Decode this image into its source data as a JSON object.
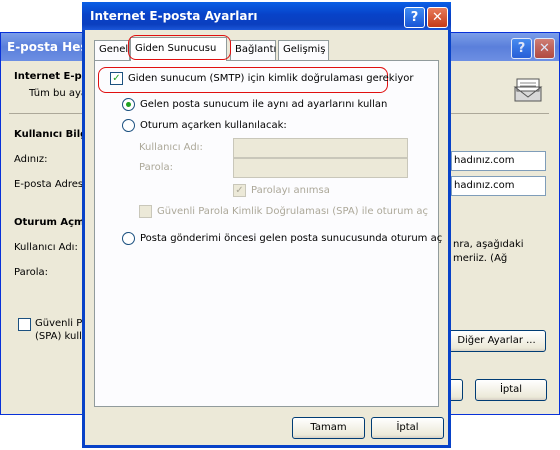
{
  "background_window": {
    "title": "E-posta Hesa",
    "heading": "Internet E-p",
    "subheading": "Tüm bu aya",
    "user_info_heading": "Kullanıcı Bilg",
    "name_label": "Adınız:",
    "email_label": "E-posta Adres",
    "name_value": "hadınız.com",
    "email_value": "hadınız.com",
    "logon_heading": "Oturum Açm",
    "username_label": "Kullanıcı Adı:",
    "password_label": "Parola:",
    "right_text_1": "nra, aşağıdaki",
    "right_text_2": "meriiz. (Ağ",
    "spa_label_1": "Güvenli Pa",
    "spa_label_2": "(SPA) kulla",
    "more_settings_button": "Diğer Ayarlar ...",
    "cancel_button": "İptal",
    "help_glyph": "?",
    "close_glyph": "✕"
  },
  "dialog": {
    "title": "Internet E-posta Ayarları",
    "help_glyph": "?",
    "close_glyph": "✕",
    "tabs": [
      {
        "label": "Genel"
      },
      {
        "label": "Giden Sunucusu"
      },
      {
        "label": "Bağlantı"
      },
      {
        "label": "Gelişmiş"
      }
    ],
    "smtp_auth_label": "Giden sunucum (SMTP) için kimlik doğrulaması gerekiyor",
    "smtp_auth_checked": true,
    "same_settings_label": "Gelen posta sunucum ile aynı ad ayarlarını kullan",
    "logon_using_label": "Oturum açarken kullanılacak:",
    "username_label": "Kullanıcı Adı:",
    "password_label": "Parola:",
    "remember_password_label": "Parolayı anımsa",
    "spa_label": "Güvenli Parola Kimlik Doğrulaması (SPA) ile oturum aç",
    "pop_before_smtp_label": "Posta gönderimi öncesi gelen posta sunucusunda oturum aç",
    "ok_button": "Tamam",
    "cancel_button": "İptal",
    "check_glyph": "✓"
  },
  "colors": {
    "highlight": "#e01010",
    "xp_titlebar": "#0842c8",
    "dialog_bg": "#ece9d8"
  }
}
